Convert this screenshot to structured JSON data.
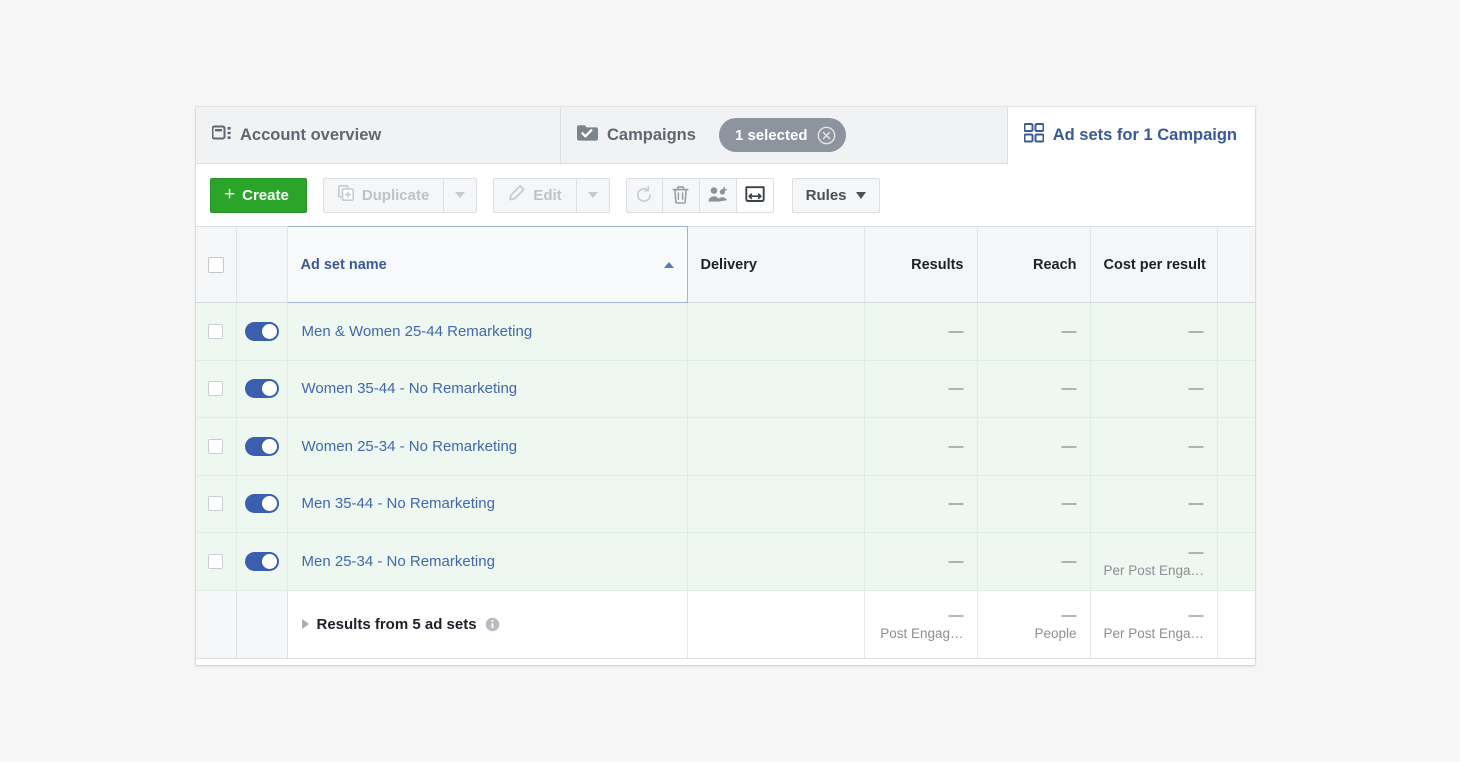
{
  "tabs": [
    {
      "id": "account-overview",
      "label": "Account overview",
      "icon": "account-overview-icon",
      "active": false
    },
    {
      "id": "campaigns",
      "label": "Campaigns",
      "icon": "campaigns-icon",
      "active": false
    },
    {
      "id": "ad-sets",
      "label": "Ad sets for 1 Campaign",
      "icon": "ad-sets-grid-icon",
      "active": true
    }
  ],
  "selection_pill": {
    "label": "1 selected",
    "close_icon": "close-circle-icon"
  },
  "toolbar": {
    "create_label": "Create",
    "duplicate_label": "Duplicate",
    "edit_label": "Edit",
    "rules_label": "Rules",
    "icons": [
      {
        "name": "refresh-icon",
        "active": false
      },
      {
        "name": "trash-icon",
        "active": false
      },
      {
        "name": "audience-icon",
        "active": false
      },
      {
        "name": "export-icon",
        "active": true
      }
    ]
  },
  "table": {
    "columns": [
      {
        "key": "checkbox",
        "label": "",
        "align": "center"
      },
      {
        "key": "toggle",
        "label": "",
        "align": "center"
      },
      {
        "key": "name",
        "label": "Ad set name",
        "align": "left",
        "sorted": true,
        "sort_dir": "asc"
      },
      {
        "key": "delivery",
        "label": "Delivery",
        "align": "left"
      },
      {
        "key": "results",
        "label": "Results",
        "align": "right"
      },
      {
        "key": "reach",
        "label": "Reach",
        "align": "right"
      },
      {
        "key": "cost_per_result",
        "label": "Cost per result",
        "align": "right"
      },
      {
        "key": "spacer",
        "label": "",
        "align": "right"
      }
    ],
    "rows": [
      {
        "name": "Men & Women 25-44 Remarketing",
        "enabled": true,
        "selected": false,
        "delivery": "",
        "results": "—",
        "reach": "—",
        "cost_per_result": "—",
        "cost_sub": ""
      },
      {
        "name": "Women 35-44 - No Remarketing",
        "enabled": true,
        "selected": false,
        "delivery": "",
        "results": "—",
        "reach": "—",
        "cost_per_result": "—",
        "cost_sub": ""
      },
      {
        "name": "Women 25-34 - No Remarketing",
        "enabled": true,
        "selected": false,
        "delivery": "",
        "results": "—",
        "reach": "—",
        "cost_per_result": "—",
        "cost_sub": ""
      },
      {
        "name": "Men 35-44 - No Remarketing",
        "enabled": true,
        "selected": false,
        "delivery": "",
        "results": "—",
        "reach": "—",
        "cost_per_result": "—",
        "cost_sub": ""
      },
      {
        "name": "Men 25-34 - No Remarketing",
        "enabled": true,
        "selected": false,
        "delivery": "",
        "results": "—",
        "reach": "—",
        "cost_per_result": "—",
        "cost_sub": "Per Post Enga…"
      }
    ],
    "footer": {
      "label": "Results from 5 ad sets",
      "info_icon": "info-icon",
      "expand_icon": "expand-triangle-icon",
      "delivery": "",
      "results": "—",
      "results_sub": "Post Engag…",
      "reach": "—",
      "reach_sub": "People",
      "cost_per_result": "—",
      "cost_sub": "Per Post Enga…"
    }
  },
  "colors": {
    "accent_blue": "#3b5998",
    "link_blue": "#4267b2",
    "create_green": "#2aa52a",
    "row_green": "#eef8f0",
    "toggle_blue": "#3b5fae",
    "pill_gray": "#8d949e"
  }
}
